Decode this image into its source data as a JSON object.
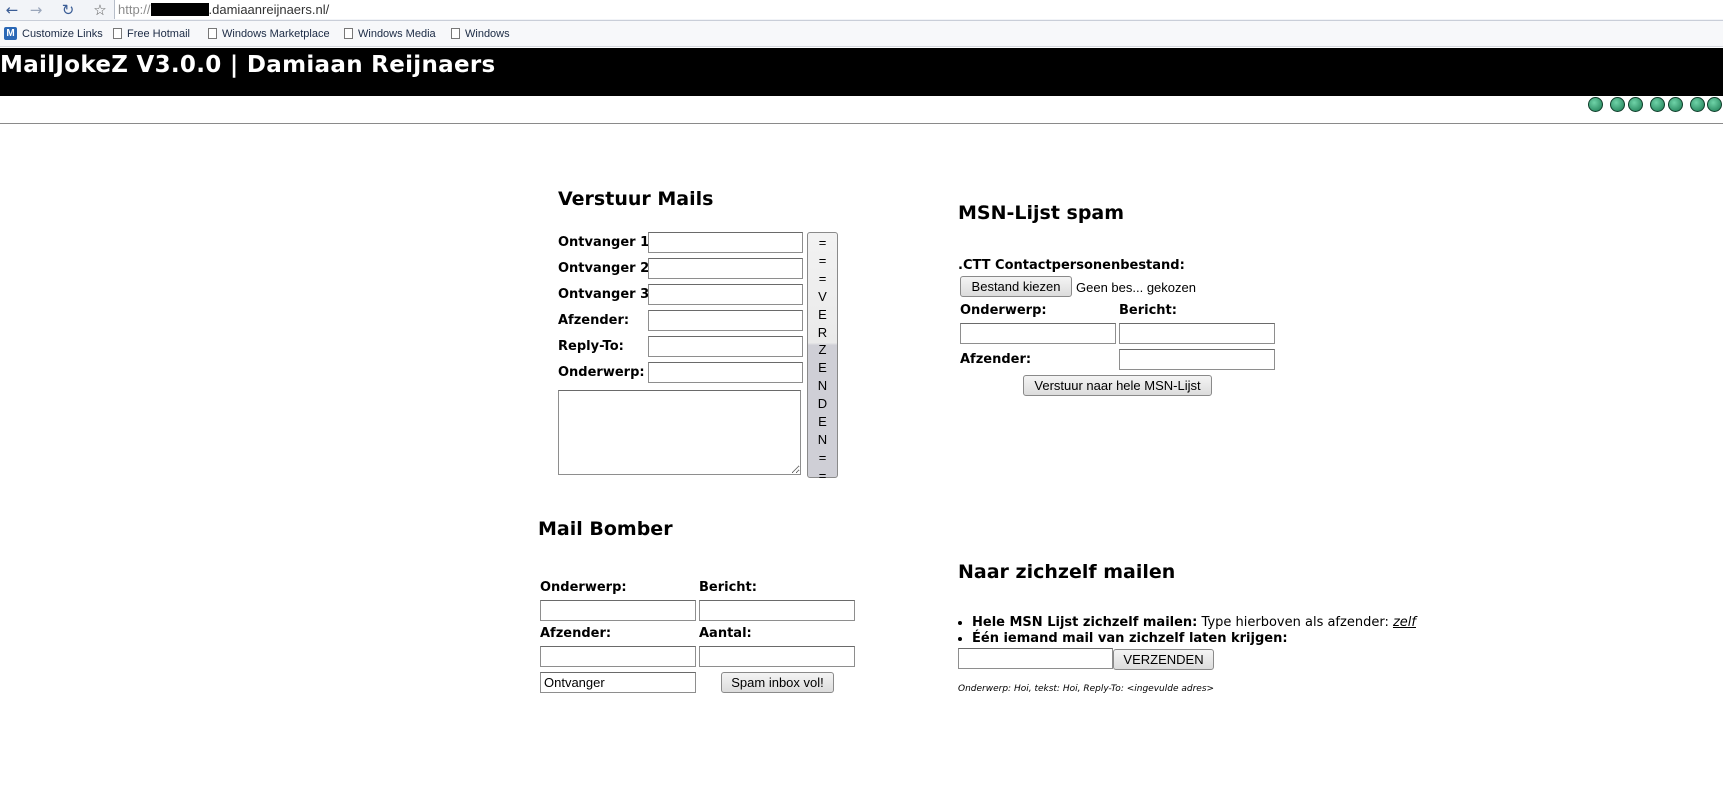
{
  "browser": {
    "url_prefix": "http://",
    "url_domain": ".damiaanreijnaers.nl/",
    "bookmarks": [
      "Customize Links",
      "Free Hotmail",
      "Windows Marketplace",
      "Windows Media",
      "Windows"
    ]
  },
  "header": {
    "title": "MailJokeZ V3.0.0 | Damiaan Reijnaers"
  },
  "send_mails": {
    "title": "Verstuur Mails",
    "labels": [
      "Ontvanger 1:",
      "Ontvanger 2:",
      "Ontvanger 3:",
      "Afzender:",
      "Reply-To:",
      "Onderwerp:"
    ],
    "submit_chars": [
      "=",
      "=",
      "=",
      "V",
      "E",
      "R",
      "Z",
      "E",
      "N",
      "D",
      "E",
      "N",
      "=",
      "="
    ]
  },
  "msn_spam": {
    "title": "MSN-Lijst spam",
    "file_label": ".CTT Contactpersonenbestand:",
    "file_button": "Bestand kiezen",
    "file_status": "Geen bes... gekozen",
    "subject_label": "Onderwerp:",
    "message_label": "Bericht:",
    "sender_label": "Afzender:",
    "submit": "Verstuur naar hele MSN-Lijst"
  },
  "bomber": {
    "title": "Mail Bomber",
    "subject_label": "Onderwerp:",
    "message_label": "Bericht:",
    "sender_label": "Afzender:",
    "count_label": "Aantal:",
    "recipient_value": "Ontvanger",
    "submit": "Spam inbox vol!"
  },
  "self_mail": {
    "title": "Naar zichzelf mailen",
    "tip1_bold": "Hele MSN Lijst zichzelf mailen:",
    "tip1_text": "Type hierboven als afzender:",
    "tip1_link": "zelf",
    "tip2_bold": "Één iemand mail van zichzelf laten krijgen:",
    "submit": "VERZENDEN",
    "note": "Onderwerp: Hoi, tekst: Hoi, Reply-To: <ingevulde adres>"
  },
  "colors": {
    "header_bg": "#000000",
    "header_text": "#ffffff",
    "smiley": "#2e9a6b"
  }
}
